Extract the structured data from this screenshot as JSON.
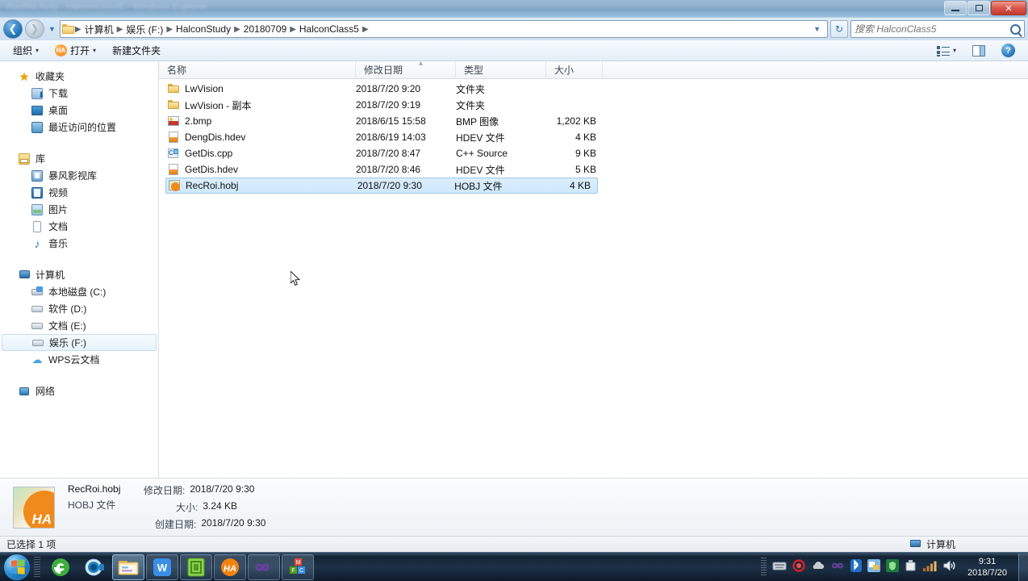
{
  "window": {
    "title_blur": "RecRoi.hobj - HalconClass5 - Windows Explorer",
    "minimize_label": "最小化",
    "maximize_label": "还原",
    "close_label": "关闭"
  },
  "address_bar": {
    "back_label": "后退",
    "forward_label": "前进",
    "history_label": "最近浏览的位置",
    "refresh_label": "刷新",
    "dropdown_label": "前往",
    "breadcrumbs": [
      "计算机",
      "娱乐 (F:)",
      "HalconStudy",
      "20180709",
      "HalconClass5"
    ],
    "separator": "▶"
  },
  "search": {
    "placeholder": "搜索 HalconClass5",
    "value": "",
    "icon": "search-icon"
  },
  "command_bar": {
    "organize": "组织",
    "open": "打开",
    "new_folder": "新建文件夹",
    "caret": "▾",
    "open_badge": "HA",
    "view_icon": "view-list-icon",
    "view_caret": "▾",
    "preview_pane_icon": "preview-pane-icon",
    "help_icon": "help-icon",
    "help_glyph": "?"
  },
  "sidebar": {
    "groups": [
      {
        "header": {
          "label": "收藏夹",
          "icon": "star-icon"
        },
        "items": [
          {
            "label": "下载",
            "icon": "download-folder-icon",
            "selected": false
          },
          {
            "label": "桌面",
            "icon": "desktop-icon",
            "selected": false
          },
          {
            "label": "最近访问的位置",
            "icon": "recent-places-icon",
            "selected": false
          }
        ]
      },
      {
        "header": {
          "label": "库",
          "icon": "library-icon"
        },
        "items": [
          {
            "label": "暴风影视库",
            "icon": "baofeng-library-icon",
            "selected": false
          },
          {
            "label": "视频",
            "icon": "videos-icon",
            "selected": false
          },
          {
            "label": "图片",
            "icon": "pictures-icon",
            "selected": false
          },
          {
            "label": "文档",
            "icon": "documents-icon",
            "selected": false
          },
          {
            "label": "音乐",
            "icon": "music-icon",
            "selected": false
          }
        ]
      },
      {
        "header": {
          "label": "计算机",
          "icon": "computer-icon"
        },
        "items": [
          {
            "label": "本地磁盘 (C:)",
            "icon": "system-drive-icon",
            "selected": false
          },
          {
            "label": "软件 (D:)",
            "icon": "drive-icon",
            "selected": false
          },
          {
            "label": "文档 (E:)",
            "icon": "drive-icon",
            "selected": false
          },
          {
            "label": "娱乐 (F:)",
            "icon": "drive-icon",
            "selected": true
          },
          {
            "label": "WPS云文档",
            "icon": "cloud-icon",
            "selected": false
          }
        ]
      },
      {
        "header": {
          "label": "网络",
          "icon": "network-icon"
        },
        "items": []
      }
    ]
  },
  "file_list": {
    "columns": [
      "名称",
      "修改日期",
      "类型",
      "大小"
    ],
    "sort_indicator": "▲",
    "rows": [
      {
        "name": "LwVision",
        "date": "2018/7/20 9:20",
        "type": "文件夹",
        "size": "",
        "icon": "folder-icon",
        "selected": false
      },
      {
        "name": "LwVision - 副本",
        "date": "2018/7/20 9:19",
        "type": "文件夹",
        "size": "",
        "icon": "folder-icon",
        "selected": false
      },
      {
        "name": "2.bmp",
        "date": "2018/6/15 15:58",
        "type": "BMP 图像",
        "size": "1,202 KB",
        "icon": "bmp-image-icon",
        "selected": false
      },
      {
        "name": "DengDis.hdev",
        "date": "2018/6/19 14:03",
        "type": "HDEV 文件",
        "size": "4 KB",
        "icon": "hdev-file-icon",
        "selected": false
      },
      {
        "name": "GetDis.cpp",
        "date": "2018/7/20 8:47",
        "type": "C++ Source",
        "size": "9 KB",
        "icon": "cpp-file-icon",
        "selected": false
      },
      {
        "name": "GetDis.hdev",
        "date": "2018/7/20 8:46",
        "type": "HDEV 文件",
        "size": "5 KB",
        "icon": "hdev-file-icon",
        "selected": false
      },
      {
        "name": "RecRoi.hobj",
        "date": "2018/7/20 9:30",
        "type": "HOBJ 文件",
        "size": "4 KB",
        "icon": "hobj-file-icon",
        "selected": true
      }
    ]
  },
  "details_pane": {
    "file_name": "RecRoi.hobj",
    "file_type": "HOBJ 文件",
    "modified_key": "修改日期:",
    "modified_value": "2018/7/20 9:30",
    "size_key": "大小:",
    "size_value": "3.24 KB",
    "created_key": "创建日期:",
    "created_value": "2018/7/20 9:30",
    "thumbnail_text": "HA"
  },
  "status_bar": {
    "selection_text": "已选择 1 项",
    "location_label": "计算机",
    "location_icon": "computer-icon"
  },
  "taskbar": {
    "start_label": "开始",
    "items": [
      {
        "name": "browser-360-icon",
        "label": "360安全浏览器",
        "active": false
      },
      {
        "name": "camera-app-icon",
        "label": "摄像头",
        "active": false
      },
      {
        "name": "windows-explorer-icon",
        "label": "Windows 资源管理器",
        "active": true
      },
      {
        "name": "wps-writer-icon",
        "label": "WPS 文字",
        "active": false
      },
      {
        "name": "green-app-icon",
        "label": "应用程序",
        "active": false
      },
      {
        "name": "halcon-icon",
        "label": "HALCON",
        "active": false
      },
      {
        "name": "visual-studio-icon",
        "label": "Visual Studio",
        "active": false
      },
      {
        "name": "office-tools-icon",
        "label": "Office 工具",
        "active": false
      }
    ],
    "tray_icons": [
      "keyboard-input-icon",
      "recording-icon",
      "cloud-sync-icon",
      "infinity-icon",
      "bluetooth-icon",
      "network-manager-icon",
      "shield-icon",
      "usb-eject-icon",
      "signal-icon",
      "volume-icon"
    ],
    "clock_time": "9:31",
    "clock_date": "2018/7/20",
    "show_desktop_label": "显示桌面"
  },
  "colors": {
    "selection_blue": "#cfe7fb",
    "accent_orange": "#f08a1c",
    "folder_yellow": "#f3c969",
    "close_red": "#c23b30"
  }
}
